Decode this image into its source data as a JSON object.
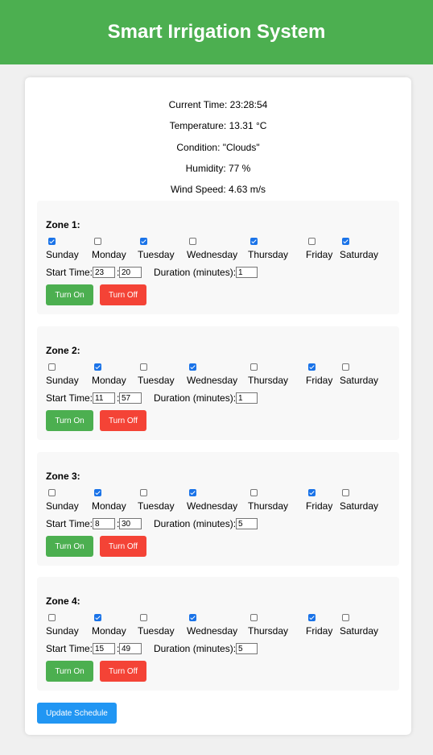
{
  "header": {
    "title": "Smart Irrigation System"
  },
  "weather": {
    "current_time": "Current Time: 23:28:54",
    "temperature": "Temperature: 13.31 °C",
    "condition": "Condition: \"Clouds\"",
    "humidity": "Humidity: 77 %",
    "wind_speed": "Wind Speed: 4.63 m/s"
  },
  "labels": {
    "start_time": "Start Time:",
    "duration": "Duration (minutes):",
    "turn_on": "Turn On",
    "turn_off": "Turn Off",
    "time_sep": ":"
  },
  "days": [
    "Sunday",
    "Monday",
    "Tuesday",
    "Wednesday",
    "Thursday",
    "Friday",
    "Saturday"
  ],
  "zones": [
    {
      "title": "Zone 1:",
      "checked": [
        true,
        false,
        true,
        false,
        true,
        false,
        true
      ],
      "hour": "23",
      "minute": "20",
      "duration": "1"
    },
    {
      "title": "Zone 2:",
      "checked": [
        false,
        true,
        false,
        true,
        false,
        true,
        false
      ],
      "hour": "11",
      "minute": "57",
      "duration": "1"
    },
    {
      "title": "Zone 3:",
      "checked": [
        false,
        true,
        false,
        true,
        false,
        true,
        false
      ],
      "hour": "8",
      "minute": "30",
      "duration": "5"
    },
    {
      "title": "Zone 4:",
      "checked": [
        false,
        true,
        false,
        true,
        false,
        true,
        false
      ],
      "hour": "15",
      "minute": "49",
      "duration": "5"
    }
  ],
  "update_button": "Update Schedule",
  "colors": {
    "header": "#4caf50",
    "turn_on": "#4caf50",
    "turn_off": "#f44336",
    "update": "#2196f3",
    "checkbox": "#1a73e8"
  }
}
